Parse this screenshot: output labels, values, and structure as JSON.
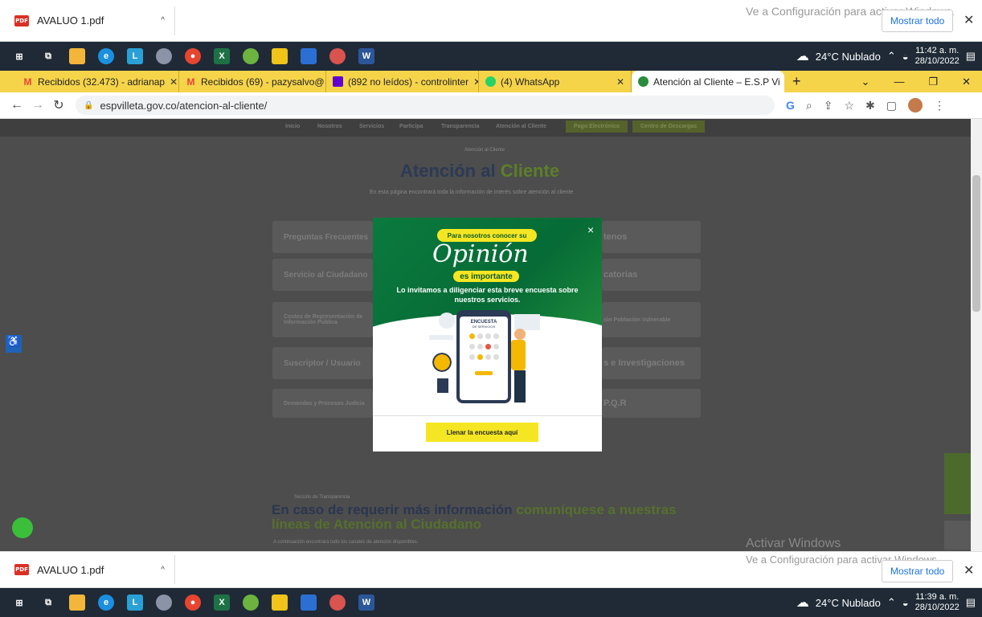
{
  "download_bar_top": {
    "file_name": "AVALUO 1.pdf",
    "pdf_badge": "PDF",
    "watermark": "Ve a Configuración para activar Windows.",
    "show_all": "Mostrar todo"
  },
  "taskbar_top": {
    "weather": "24°C Nublado",
    "time": "11:42 a. m.",
    "date": "28/10/2022"
  },
  "tabs": [
    {
      "label": "Recibidos (32.473) - adrianap",
      "favicon": "gmail-icon",
      "color": "#ea4335"
    },
    {
      "label": "Recibidos (69) - pazysalvo@",
      "favicon": "gmail-icon",
      "color": "#ea4335"
    },
    {
      "label": "(892 no leídos) - controlinter",
      "favicon": "mail-icon",
      "color": "#6001d2"
    },
    {
      "label": "(4) WhatsApp",
      "favicon": "whatsapp-icon",
      "color": "#25d366"
    },
    {
      "label": "Atención al Cliente – E.S.P Vi",
      "favicon": "site-icon",
      "color": "#2a8c3c"
    }
  ],
  "address": {
    "url": "espvilleta.gov.co/atencion-al-cliente/"
  },
  "site": {
    "nav": [
      "Inicio",
      "Nosotros",
      "Servicios",
      "Participa",
      "Transparencia",
      "Atención al Cliente"
    ],
    "nav_btn1": "Pago Electrónico",
    "nav_btn2": "Centro de Descargas",
    "kicker": "Atención al Cliente",
    "title_a": "Atención al",
    "title_b": "Cliente",
    "subtitle": "En esta página encontrará toda la información de interés sobre atención al cliente",
    "cards_left": [
      "Preguntas Frecuentes",
      "Servicio al Ciudadano",
      "Costos de Representación de Información Pública",
      "Suscriptor / Usuario",
      "Demandas y Procesos Judicia"
    ],
    "cards_right": [
      "tenos",
      "catorias",
      "ión Población Vulnerable",
      "s e Investigaciones",
      "P.Q.R"
    ],
    "section_kicker": "Sección de Transparencia",
    "section_title_a": "En caso de requerir más información",
    "section_title_b": "comuníquese a nuestras líneas",
    "section_title_c": "de Atención al Ciudadano",
    "section_note": "A continuación encontrará todo los canales de atención disponibles.",
    "activar": "Activar Windows",
    "activar_sub": "Ve a Configuración para activar Windows."
  },
  "modal": {
    "close": "×",
    "pill_top": "Para nosotros conocer su",
    "script_word": "Opinión",
    "pill_mid": "es importante",
    "invite": "Lo invitamos a diligenciar esta breve encuesta sobre nuestros servicios.",
    "phone_title": "ENCUESTA",
    "phone_sub": "DE SERVICIOS",
    "cta": "Llenar la encuesta aquí"
  },
  "download_bar_bottom": {
    "file_name": "AVALUO 1.pdf",
    "show_all": "Mostrar todo"
  },
  "taskbar_bottom": {
    "weather": "24°C Nublado",
    "time": "11:39 a. m.",
    "date": "28/10/2022"
  }
}
